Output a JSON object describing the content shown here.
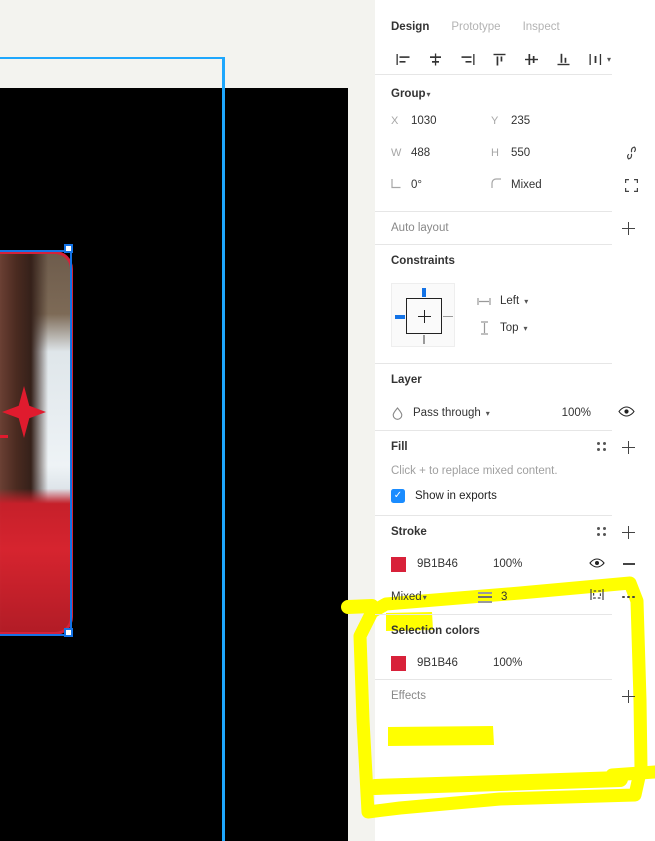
{
  "tabs": [
    {
      "label": "Design",
      "active": true
    },
    {
      "label": "Prototype",
      "active": false
    },
    {
      "label": "Inspect",
      "active": false
    }
  ],
  "align_tools": [
    {
      "name": "align-left-icon",
      "label": "Align left"
    },
    {
      "name": "align-horizontal-centers-icon",
      "label": "Align horizontal centers"
    },
    {
      "name": "align-right-icon",
      "label": "Align right"
    },
    {
      "name": "align-top-icon",
      "label": "Align top"
    },
    {
      "name": "align-vertical-centers-icon",
      "label": "Align vertical centers"
    },
    {
      "name": "align-bottom-icon",
      "label": "Align bottom"
    },
    {
      "name": "distribute-icon",
      "label": "Tidy up"
    }
  ],
  "group": {
    "name": "Group",
    "x_key": "X",
    "x_value": "1030",
    "y_key": "Y",
    "y_value": "235",
    "w_key": "W",
    "w_value": "488",
    "h_key": "H",
    "h_value": "550",
    "rotation_value": "0°",
    "corner_value": "Mixed",
    "constrain_icon": "constrain-proportions-icon",
    "independent_corners_icon": "independent-corners-icon"
  },
  "auto_layout": {
    "title": "Auto layout",
    "add_icon": "plus-icon"
  },
  "constraints": {
    "title": "Constraints",
    "horizontal": "Left",
    "vertical": "Top",
    "horizontal_icon": "horizontal-constraint-icon",
    "vertical_icon": "vertical-constraint-icon",
    "active_marks": [
      "top",
      "left"
    ]
  },
  "layer": {
    "title": "Layer",
    "blend_mode": "Pass through",
    "opacity": "100%",
    "blend_icon": "blend-mode-icon",
    "visibility_icon": "eye-icon"
  },
  "fill": {
    "title": "Fill",
    "mixed_note": "Click + to replace mixed content.",
    "show_in_exports_label": "Show in exports",
    "show_in_exports_checked": true,
    "settings_icon": "fill-styles-icon",
    "add_icon": "plus-icon"
  },
  "stroke": {
    "title": "Stroke",
    "color_hex": "9B1B46",
    "opacity": "100%",
    "swatch_color": "#d8213a",
    "style": "Mixed",
    "weight": "3",
    "settings_icon": "stroke-styles-icon",
    "add_icon": "plus-icon",
    "visibility_icon": "eye-icon",
    "remove_icon": "minus-icon",
    "weight_icon": "stroke-weight-icon",
    "align_icon": "stroke-align-icon",
    "more_icon": "more-options-icon"
  },
  "selection_colors": {
    "title": "Selection colors",
    "color_hex": "9B1B46",
    "opacity": "100%",
    "swatch_color": "#d8213a"
  },
  "effects": {
    "title": "Effects",
    "add_icon": "plus-icon"
  },
  "annotation": {
    "type": "highlighter-rectangle",
    "color": "#ffff00",
    "targets": [
      "Stroke",
      "Selection colors"
    ]
  },
  "canvas": {
    "background_color": "#f3f3ef",
    "frame_color": "#000000",
    "selection_color": "#1ea7fd",
    "photo_stroke_color": "#d4213a",
    "sparkle_color": "#e01b2e",
    "photo_description": "Person with long dark hair wearing a red coat, standing on snow near a wooden fence"
  }
}
